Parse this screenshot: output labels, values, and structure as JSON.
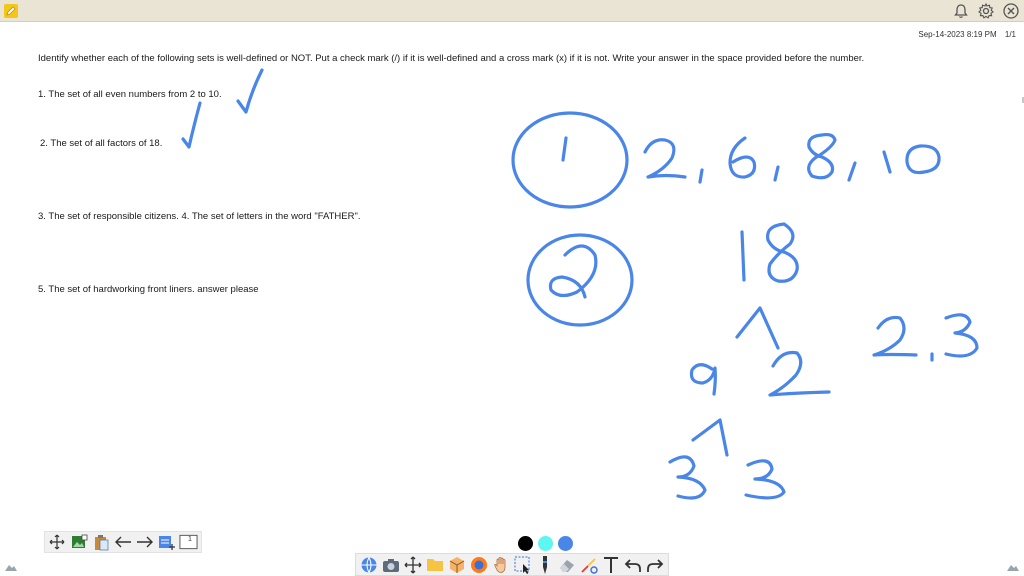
{
  "header": {
    "timestamp": "Sep-14-2023 8:19 PM",
    "page_indicator": "1/1"
  },
  "document": {
    "instruction": "Identify whether each of the following sets is well-defined or NOT. Put a check mark (/) if it is well-defined and a cross mark (x) if it is not. Write your answer in the space provided before the number.",
    "item1": "1. The set of all even numbers from 2 to 10.",
    "item2": "2. The set of all factors of 18.",
    "item3": "3. The set of responsible citizens. 4. The set of letters in the word \"FATHER\".",
    "item5": "5. The set of hardworking front liners. answer please"
  },
  "handwriting": {
    "ink_color": "#4a86e8",
    "notes": [
      "1",
      "2, 6, 8, 10",
      "2",
      "18",
      "9",
      "2",
      "3",
      "3",
      "2.3"
    ]
  },
  "toolbar_left": {
    "page_box_number": "1",
    "icons": [
      "move-icon",
      "image-icon",
      "clipboard-icon",
      "arrow-left-icon",
      "arrow-right-icon",
      "add-page-icon",
      "page-icon"
    ]
  },
  "palette": {
    "colors": [
      "#000000",
      "#5ff5f0",
      "#4a86e8"
    ]
  },
  "toolbar_bottom": {
    "icons": [
      "globe-icon",
      "camera-icon",
      "move-icon",
      "folder-icon",
      "3d-cube-icon",
      "browser-icon",
      "hand-icon",
      "select-icon",
      "pen-icon",
      "eraser-icon",
      "shapes-icon",
      "text-icon",
      "undo-icon",
      "redo-icon"
    ]
  },
  "colors": {
    "topbar": "#e9e4d4",
    "accent": "#4a86e8"
  }
}
